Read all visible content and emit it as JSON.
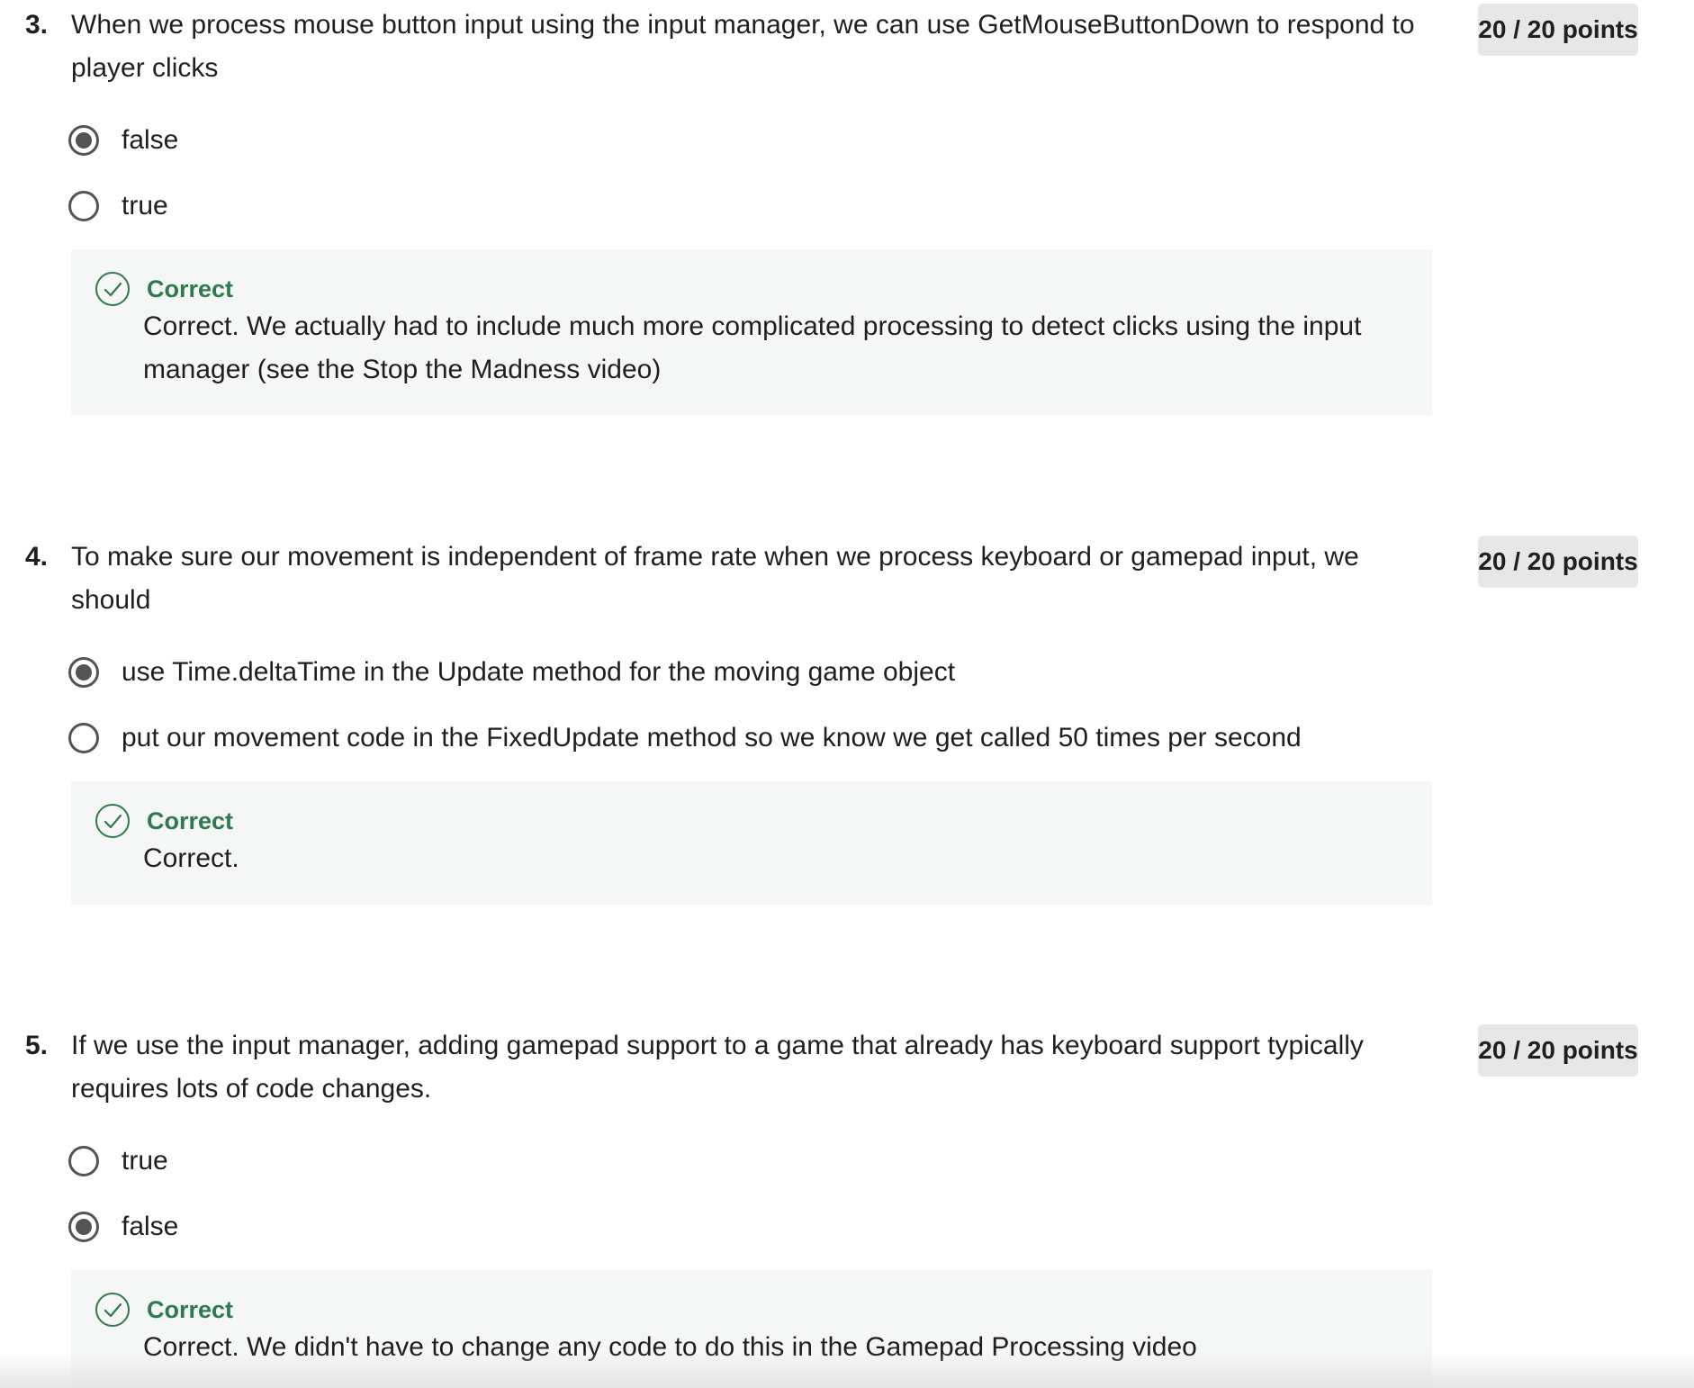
{
  "questions": [
    {
      "number": "3.",
      "text": "When we process mouse button input using the input manager, we can use GetMouseButtonDown to respond to player clicks",
      "points": "20 / 20 points",
      "options": [
        {
          "label": "false",
          "selected": true
        },
        {
          "label": "true",
          "selected": false
        }
      ],
      "feedback": {
        "status": "Correct",
        "icon": "check-circle-icon",
        "text": "Correct. We actually had to include much more complicated processing to detect clicks using the input manager (see the Stop the Madness video)"
      }
    },
    {
      "number": "4.",
      "text": "To make sure our movement is independent of frame rate when we process keyboard or gamepad input, we should",
      "points": "20 / 20 points",
      "options": [
        {
          "label": "use Time.deltaTime in the Update method for the moving game object",
          "selected": true
        },
        {
          "label": "put our movement code in the FixedUpdate method so we know we get called 50 times per second",
          "selected": false
        }
      ],
      "feedback": {
        "status": "Correct",
        "icon": "check-circle-icon",
        "text": "Correct."
      }
    },
    {
      "number": "5.",
      "text": "If we use the input manager, adding gamepad support to a game that already has keyboard support typically requires lots of code changes.",
      "points": "20 / 20 points",
      "options": [
        {
          "label": "true",
          "selected": false
        },
        {
          "label": "false",
          "selected": true
        }
      ],
      "feedback": {
        "status": "Correct",
        "icon": "check-circle-icon",
        "text": "Correct. We didn't have to change any code to do this in the Gamepad Processing video"
      }
    }
  ],
  "colors": {
    "correct_green": "#2e7a4c",
    "feedback_bg": "#f5f7f6",
    "badge_bg": "#e5e7e8",
    "radio_gray": "#545454"
  }
}
